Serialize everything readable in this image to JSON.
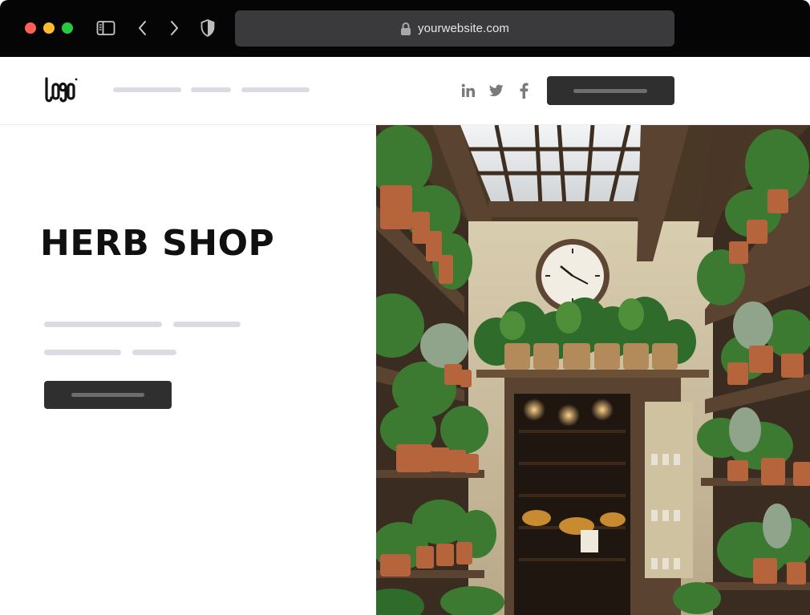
{
  "browser": {
    "url": "yourwebsite.com",
    "icons": {
      "sidebar": "sidebar-toggle-icon",
      "back": "chevron-left-icon",
      "forward": "chevron-right-icon",
      "privacy": "shield-icon",
      "lock": "lock-icon"
    }
  },
  "header": {
    "logo_text": "LOGO",
    "nav_items": [
      "",
      "",
      ""
    ],
    "social": [
      "linkedin-icon",
      "twitter-icon",
      "facebook-icon"
    ],
    "cta_label": ""
  },
  "hero": {
    "title": "HERB SHOP",
    "body_lines": [
      "",
      ""
    ],
    "cta_label": "",
    "image": "greenhouse herb shop with potted plants, skylight and wall clock"
  },
  "colors": {
    "chrome_bg": "#050505",
    "address_bar": "#3a3a3c",
    "placeholder_bar": "#dcdbe4",
    "button_bg": "#2f2f30",
    "title_text": "#101010"
  }
}
